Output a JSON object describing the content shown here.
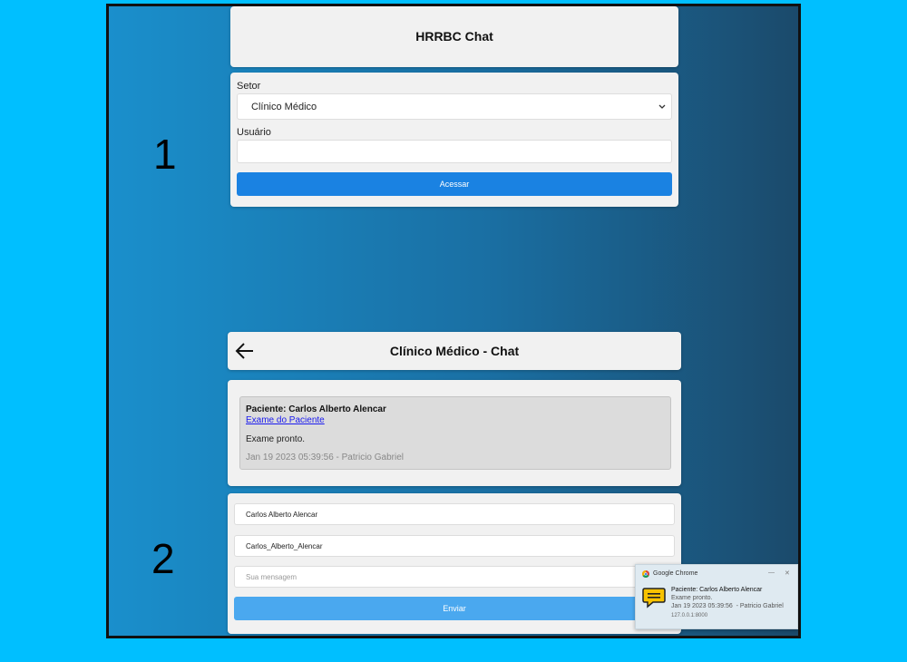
{
  "labels": {
    "one": "1",
    "two": "2"
  },
  "login": {
    "title": "HRRBC Chat",
    "setor_label": "Setor",
    "setor_value": "Clínico Médico",
    "usuario_label": "Usuário",
    "usuario_value": "",
    "submit_label": "Acessar"
  },
  "chat": {
    "title": "Clínico Médico - Chat",
    "message": {
      "patient": "Paciente: Carlos Alberto Alencar",
      "link": "Exame do Paciente",
      "text": "Exame pronto.",
      "meta": "Jan 19 2023 05:39:56 - Patricio Gabriel"
    },
    "form": {
      "field1_value": "Carlos Alberto Alencar",
      "field2_value": "Carlos_Alberto_Alencar",
      "message_placeholder": "Sua mensagem",
      "send_label": "Enviar"
    }
  },
  "notification": {
    "app": "Google Chrome",
    "title": "Paciente: Carlos Alberto Alencar",
    "line1": "Exame pronto.",
    "line2": "Jan 19 2023 05:39:56  - Patricio Gabriel",
    "origin": "127.0.0.1:8000",
    "minimize": "—",
    "close": "✕"
  },
  "colors": {
    "primary_button": "#1a82e2",
    "send_button": "#4aa8ef",
    "link": "#1a1aee"
  }
}
